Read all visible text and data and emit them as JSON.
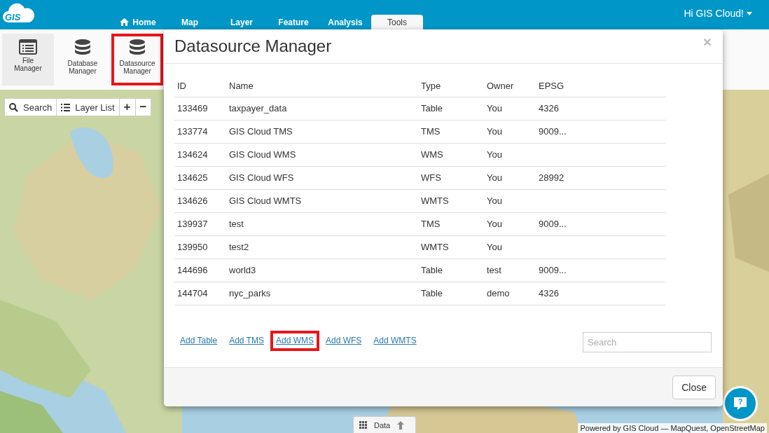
{
  "header": {
    "logo": "GIS",
    "nav": [
      {
        "label": "Home",
        "kind": "home",
        "selected": false
      },
      {
        "label": "Map",
        "selected": false
      },
      {
        "label": "Layer",
        "selected": false
      },
      {
        "label": "Feature",
        "selected": false
      },
      {
        "label": "Analysis",
        "selected": false
      },
      {
        "label": "Tools",
        "selected": true
      }
    ],
    "user": "Hi GIS Cloud!"
  },
  "tools": [
    {
      "label": "File Manager",
      "kind": "file",
      "selected": true,
      "highlighted": false
    },
    {
      "label": "Database Manager",
      "kind": "database",
      "selected": false,
      "highlighted": false
    },
    {
      "label": "Datasource Manager",
      "kind": "database",
      "selected": false,
      "highlighted": true
    }
  ],
  "map_controls": {
    "search": "Search",
    "layer_list": "Layer List",
    "zoom_in": "+",
    "zoom_out": "−"
  },
  "data_tab": "Data",
  "help_icon": "?",
  "attribution": "Powered by GIS Cloud — MapQuest, OpenStreetMap",
  "dialog": {
    "title": "Datasource Manager",
    "close_icon": "×",
    "columns": [
      "ID",
      "Name",
      "Type",
      "Owner",
      "EPSG"
    ],
    "rows": [
      [
        "133469",
        "taxpayer_data",
        "Table",
        "You",
        "4326"
      ],
      [
        "133774",
        "GIS Cloud TMS",
        "TMS",
        "You",
        "9009..."
      ],
      [
        "134624",
        "GIS Cloud WMS",
        "WMS",
        "You",
        ""
      ],
      [
        "134625",
        "GIS Cloud WFS",
        "WFS",
        "You",
        "28992"
      ],
      [
        "134626",
        "GIS Cloud WMTS",
        "WMTS",
        "You",
        ""
      ],
      [
        "139937",
        "test",
        "TMS",
        "You",
        "9009..."
      ],
      [
        "139950",
        "test2",
        "WMTS",
        "You",
        ""
      ],
      [
        "144696",
        "world3",
        "Table",
        "test",
        "9009..."
      ],
      [
        "144704",
        "nyc_parks",
        "Table",
        "demo",
        "4326"
      ]
    ],
    "links": [
      {
        "label": "Add Table",
        "highlighted": false
      },
      {
        "label": "Add TMS",
        "highlighted": false
      },
      {
        "label": "Add WMS",
        "highlighted": true
      },
      {
        "label": "Add WFS",
        "highlighted": false
      },
      {
        "label": "Add WMTS",
        "highlighted": false
      }
    ],
    "search": {
      "placeholder": "Search"
    },
    "close_button": "Close"
  }
}
